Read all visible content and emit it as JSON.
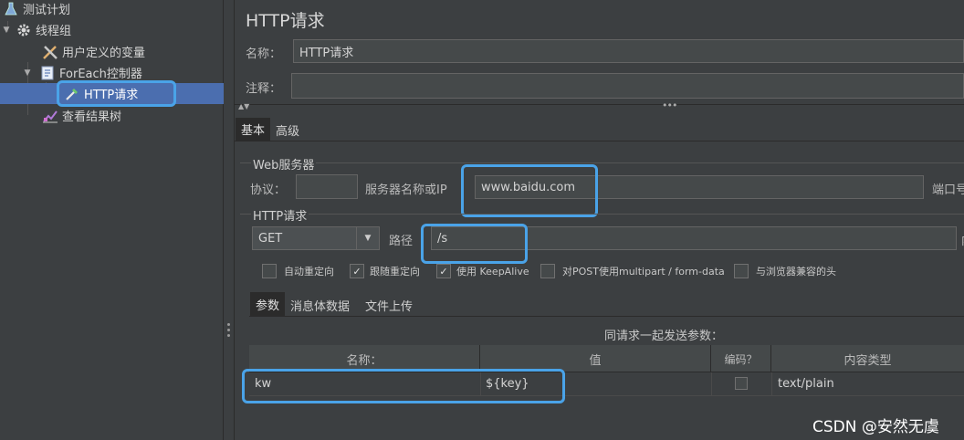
{
  "tree": {
    "items": [
      {
        "label": "测试计划",
        "icon": "flask-icon"
      },
      {
        "label": "线程组",
        "icon": "gear-icon"
      },
      {
        "label": "用户定义的变量",
        "icon": "tools-icon"
      },
      {
        "label": "ForEach控制器",
        "icon": "controller-icon"
      },
      {
        "label": "HTTP请求",
        "icon": "pipette-icon"
      },
      {
        "label": "查看结果树",
        "icon": "chart-icon"
      }
    ]
  },
  "main": {
    "title": "HTTP请求",
    "name_label": "名称：",
    "name_value": "HTTP请求",
    "comment_label": "注释：",
    "comment_value": "",
    "tabs": [
      {
        "label": "基本"
      },
      {
        "label": "高级"
      }
    ],
    "web_server": {
      "group_label": "Web服务器",
      "protocol_label": "协议：",
      "protocol_value": "",
      "server_label": "服务器名称或IP",
      "server_value": "www.baidu.com",
      "port_label": "端口号"
    },
    "http_request": {
      "group_label": "HTTP请求",
      "method": "GET",
      "path_label": "路径",
      "path_value": "/s",
      "trailing_label": "内"
    },
    "options": [
      {
        "label": "自动重定向",
        "checked": false
      },
      {
        "label": "跟随重定向",
        "checked": true
      },
      {
        "label": "使用 KeepAlive",
        "checked": true
      },
      {
        "label": "对POST使用multipart / form-data",
        "checked": false
      },
      {
        "label": "与浏览器兼容的头",
        "checked": false
      }
    ],
    "param_tabs": [
      {
        "label": "参数"
      },
      {
        "label": "消息体数据"
      },
      {
        "label": "文件上传"
      }
    ],
    "params_caption": "同请求一起发送参数：",
    "table": {
      "headers": [
        "名称：",
        "值",
        "编码？",
        "内容类型"
      ],
      "rows": [
        {
          "name": "kw",
          "value": "${key}",
          "encode": false,
          "content_type": "text/plain"
        }
      ]
    }
  },
  "watermark": "CSDN @安然无虞",
  "colors": {
    "highlight": "#4aa3e8",
    "selection": "#4b6eaf",
    "background": "#3c3f41"
  }
}
